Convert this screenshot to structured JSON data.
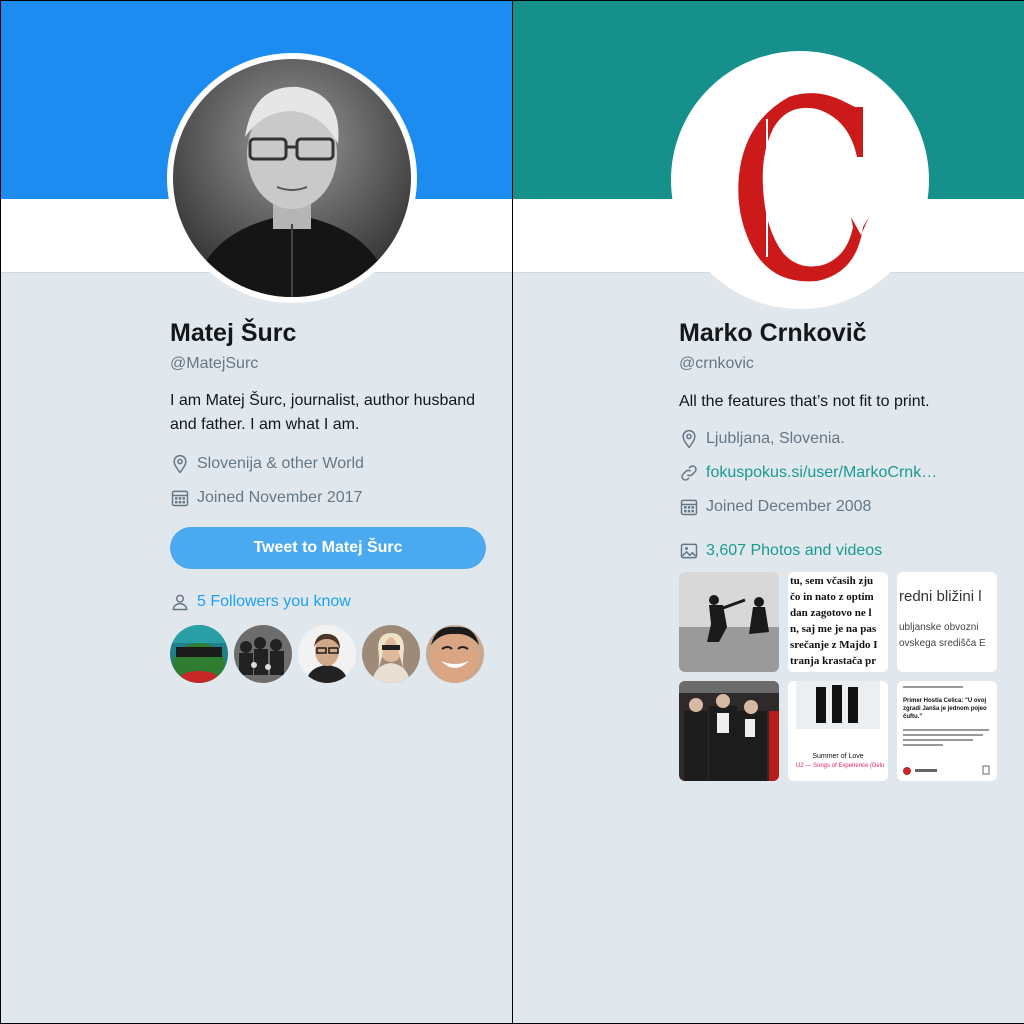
{
  "left_profile": {
    "banner_color": "#1d8cf0",
    "name": "Matej Šurc",
    "handle": "@MatejSurc",
    "bio": "I am Matej Šurc, journalist, author husband and father. I am what I am.",
    "location": "Slovenija & other World",
    "location_icon": "location-pin-icon",
    "joined": "Joined November 2017",
    "joined_icon": "calendar-icon",
    "tweet_button": "Tweet to Matej Šurc",
    "followers_you_know": "5 Followers you know",
    "followers_icon": "person-icon"
  },
  "right_profile": {
    "banner_color": "#15908a",
    "name": "Marko Crnkovič",
    "handle": "@crnkovic",
    "bio": "All the features that’s not fit to print.",
    "location": "Ljubljana, Slovenia.",
    "location_icon": "location-pin-icon",
    "website": "fokuspokus.si/user/MarkoCrnk…",
    "website_icon": "link-icon",
    "joined": "Joined December 2008",
    "joined_icon": "calendar-icon",
    "photos": "3,607 Photos and videos",
    "photos_icon": "image-icon",
    "thumbnails": {
      "t2_lines": [
        "tu, sem včasih zju",
        "čo in nato z optim",
        "dan zagotovo ne l",
        "n, saj me je na pas",
        "srečanje z Majdo I",
        "tranja krastača pr"
      ],
      "t3_lines": [
        "redni bližini l",
        "ubljanske obvozni",
        "ovskega središča E"
      ],
      "t5_caption": "Summer of Love",
      "t5_sub": "U2 — Songs of Experience (Delu",
      "t6_head": "Primer Hostla Celica: \"U ovoj zgradi Janša je jednom pojeo čuftu.\""
    }
  }
}
